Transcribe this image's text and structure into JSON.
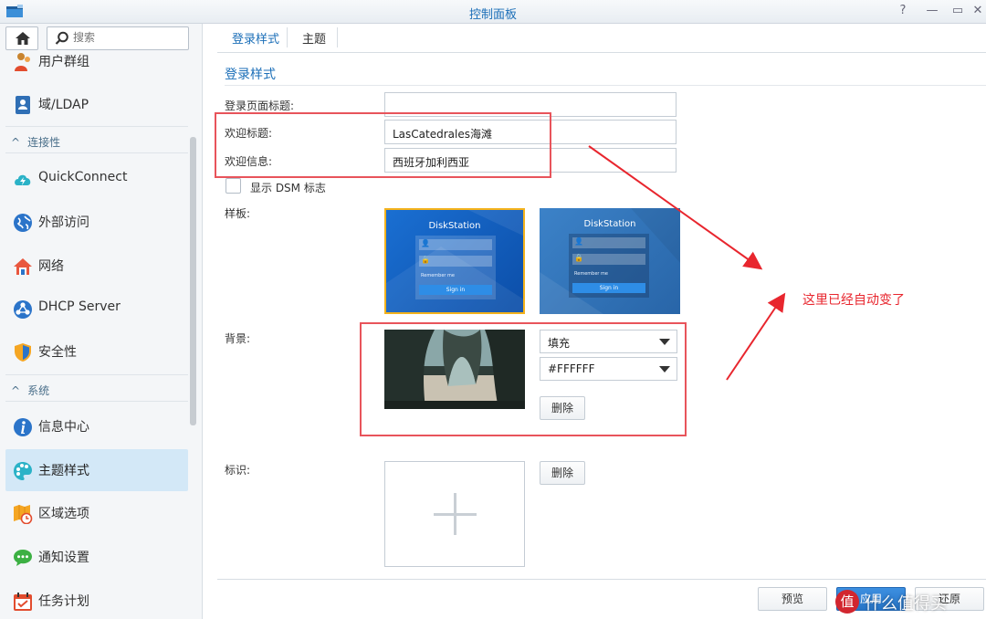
{
  "window": {
    "title": "控制面板",
    "help_glyph": "?",
    "minimize_glyph": "—",
    "maximize_glyph": "▭",
    "close_glyph": "✕"
  },
  "sidebar": {
    "search_placeholder": "搜索",
    "items": [
      {
        "label": "用户群组",
        "icon": "user-group-icon"
      },
      {
        "label": "域/LDAP",
        "icon": "domain-ldap-icon"
      },
      {
        "label": "QuickConnect",
        "icon": "quickconnect-icon"
      },
      {
        "label": "外部访问",
        "icon": "external-access-icon"
      },
      {
        "label": "网络",
        "icon": "network-icon"
      },
      {
        "label": "DHCP Server",
        "icon": "dhcp-server-icon"
      },
      {
        "label": "安全性",
        "icon": "security-shield-icon"
      },
      {
        "label": "信息中心",
        "icon": "info-center-icon"
      },
      {
        "label": "主题样式",
        "icon": "theme-palette-icon",
        "active": true
      },
      {
        "label": "区域选项",
        "icon": "regional-options-icon"
      },
      {
        "label": "通知设置",
        "icon": "notification-icon"
      },
      {
        "label": "任务计划",
        "icon": "task-scheduler-icon"
      }
    ],
    "sections": [
      {
        "label": "连接性"
      },
      {
        "label": "系统"
      }
    ]
  },
  "tabs": [
    {
      "label": "登录样式",
      "active": true
    },
    {
      "label": "主题",
      "active": false
    }
  ],
  "form": {
    "section_title": "登录样式",
    "login_title_label": "登录页面标题:",
    "login_title_value": "",
    "welcome_title_label": "欢迎标题:",
    "welcome_title_value": "LasCatedrales海滩",
    "welcome_msg_label": "欢迎信息:",
    "welcome_msg_value": "西班牙加利西亚",
    "show_dsm_logo_label": "显示 DSM 标志",
    "template_label": "样板:",
    "templates": [
      {
        "title": "DiskStation",
        "remember": "Remember me",
        "signin": "Sign in",
        "selected": true
      },
      {
        "title": "DiskStation",
        "remember": "Remember me",
        "signin": "Sign in",
        "selected": false
      }
    ],
    "background_label": "背景:",
    "background_mode": "填充",
    "background_color": "#FFFFFF",
    "delete_label": "删除",
    "logo_label": "标识:",
    "logo_delete_label": "删除"
  },
  "footer": {
    "preview_label": "预览",
    "apply_label": "应用",
    "reset_label": "还原"
  },
  "annotation": {
    "text": "这里已经自动变了"
  },
  "watermark": {
    "badge": "值",
    "text": "什么值得买"
  },
  "colors": {
    "accent": "#1c6fb8",
    "annotation_red": "#e8545b",
    "template_selected_border": "#f3b21c"
  }
}
